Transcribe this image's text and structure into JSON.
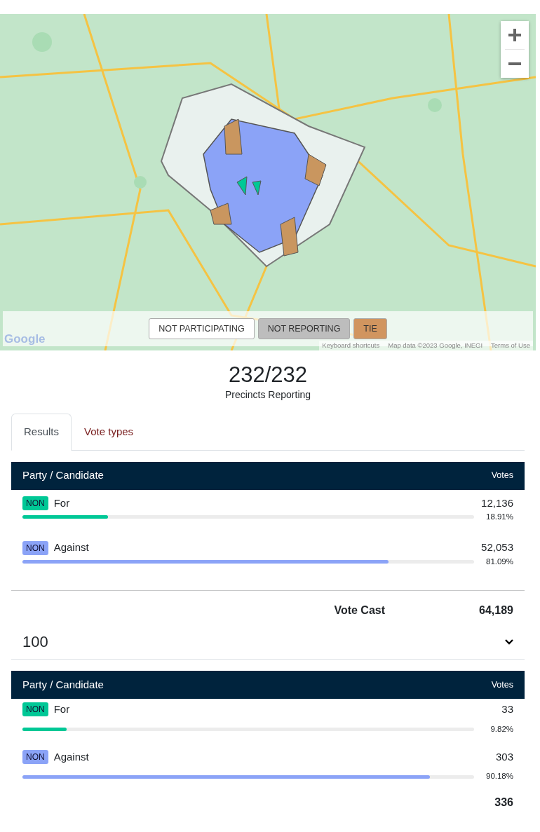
{
  "map": {
    "legend": [
      {
        "label": "NOT PARTICIPATING",
        "color": "#ffffff"
      },
      {
        "label": "NOT REPORTING",
        "color": "#bdbdbd"
      },
      {
        "label": "TIE",
        "color": "#d1955f"
      }
    ],
    "logo": "Google",
    "attribution": [
      "Keyboard shortcuts",
      "Map data ©2023 Google, INEGI",
      "Terms of Use"
    ]
  },
  "summary": {
    "count": "232/232",
    "label": "Precincts Reporting"
  },
  "tabs": [
    {
      "label": "Results",
      "selected": true
    },
    {
      "label": "Vote types",
      "selected": false
    }
  ],
  "results": {
    "columns": [
      "Party / Candidate",
      "Votes"
    ],
    "rows": [
      {
        "party": "NON",
        "name": "For",
        "votes": "12,136",
        "percent": "18.91%",
        "level": 0.1891,
        "color": "#00c896"
      },
      {
        "party": "NON",
        "name": "Against",
        "votes": "52,053",
        "percent": "81.09%",
        "level": 0.8109,
        "color": "#8ba3f7"
      }
    ],
    "total_label": "Vote Cast",
    "total": "64,189"
  },
  "precinct": {
    "selected": "100",
    "columns": [
      "Party / Candidate",
      "Votes"
    ],
    "rows": [
      {
        "party": "NON",
        "name": "For",
        "votes": "33",
        "percent": "9.82%",
        "level": 0.0982,
        "color": "#00c896"
      },
      {
        "party": "NON",
        "name": "Against",
        "votes": "303",
        "percent": "90.18%",
        "level": 0.9018,
        "color": "#8ba3f7"
      }
    ],
    "total": "336"
  }
}
